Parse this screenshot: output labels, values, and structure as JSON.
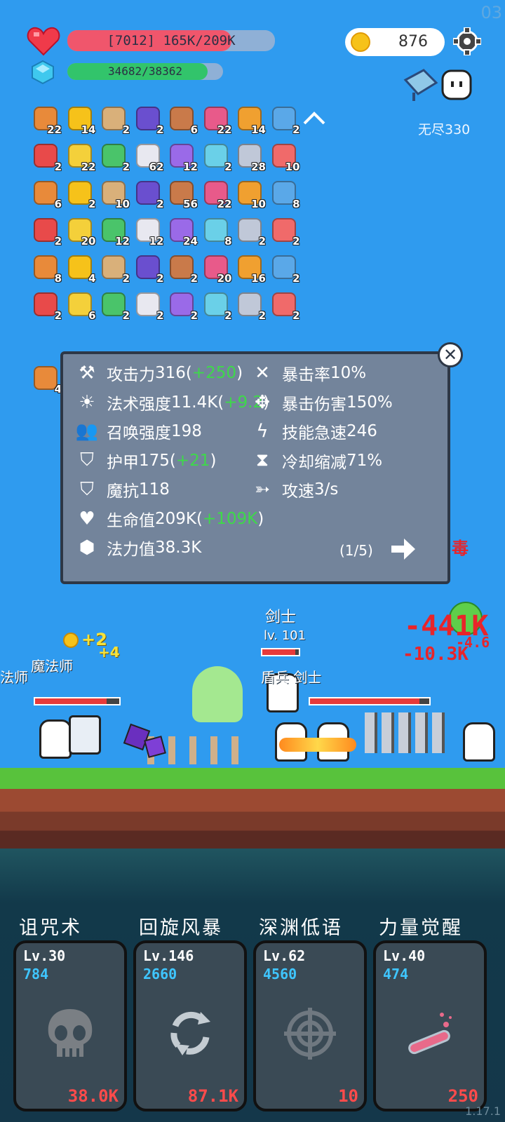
{
  "corner_time": "03",
  "version": "1.17.1",
  "hud": {
    "hp_text": "[7012] 165K/209K",
    "hp_fraction": 0.79,
    "hp_color": "#f0566c",
    "mana_text": "34682/38362",
    "mana_fraction": 0.9,
    "mana_color": "#32c46b",
    "coins": "876",
    "mode_label": "无尽330"
  },
  "items": {
    "row1": [
      "22",
      "14",
      "2",
      "2",
      "6",
      "22",
      "14",
      "2"
    ],
    "row2": [
      "2",
      "22",
      "2",
      "62",
      "12",
      "2",
      "28",
      "10"
    ],
    "row3": [
      "6",
      "2",
      "10",
      "2",
      "56",
      "22",
      "10",
      "8"
    ],
    "row4": [
      "2",
      "20",
      "12",
      "12",
      "24",
      "8",
      "2",
      "2"
    ],
    "row5": [
      "8",
      "4",
      "2",
      "2",
      "2",
      "20",
      "16",
      "2"
    ],
    "row6": [
      "2",
      "6",
      "2",
      "2",
      "2",
      "2",
      "2",
      "2"
    ],
    "row7": [
      "4"
    ]
  },
  "stats": {
    "left": [
      {
        "icon": "axe-icon",
        "label": "攻击力",
        "value": "316",
        "bonus": "+250"
      },
      {
        "icon": "sun-icon",
        "label": "法术强度",
        "value": "11.4K",
        "bonus": "+9.2"
      },
      {
        "icon": "summon-icon",
        "label": "召唤强度",
        "value": "198",
        "bonus": ""
      },
      {
        "icon": "shield-icon",
        "label": "护甲",
        "value": "175",
        "bonus": "+21"
      },
      {
        "icon": "magic-shield-icon",
        "label": "魔抗",
        "value": "118",
        "bonus": ""
      },
      {
        "icon": "heart-icon",
        "label": "生命值",
        "value": "209K",
        "bonus": "+109K"
      },
      {
        "icon": "crystal-icon",
        "label": "法力值",
        "value": "38.3K",
        "bonus": ""
      }
    ],
    "right": [
      {
        "icon": "crossed-swords-icon",
        "label": "暴击率",
        "value": "10%"
      },
      {
        "icon": "burst-icon",
        "label": "暴击伤害",
        "value": "150%"
      },
      {
        "icon": "lightning-icon",
        "label": "技能急速",
        "value": "246"
      },
      {
        "icon": "hourglass-icon",
        "label": "冷却缩减",
        "value": "71%"
      },
      {
        "icon": "bow-icon",
        "label": "攻速",
        "value": "3/s"
      }
    ],
    "page": "(1/5)"
  },
  "battle": {
    "swordsman_name": "剑士",
    "swordsman_level": "lv. 101",
    "coin_gain": "+2",
    "coin_gain2": "+4",
    "left_name": "魔法师",
    "left_sub": "法师",
    "right_names": "盾兵 剑士",
    "dmg_big": "-441K",
    "dmg_mid": "-10.3K",
    "dmg_small": "-4.6",
    "poison": "毒"
  },
  "skills": [
    {
      "name": "诅咒术",
      "level": "Lv.30",
      "cost": "784",
      "value": "38.0K",
      "icon": "skull-icon"
    },
    {
      "name": "回旋风暴",
      "level": "Lv.146",
      "cost": "2660",
      "value": "87.1K",
      "icon": "cyclone-icon"
    },
    {
      "name": "深渊低语",
      "level": "Lv.62",
      "cost": "4560",
      "value": "10",
      "icon": "target-icon"
    },
    {
      "name": "力量觉醒",
      "level": "Lv.40",
      "cost": "474",
      "value": "250",
      "icon": "potion-icon"
    }
  ]
}
